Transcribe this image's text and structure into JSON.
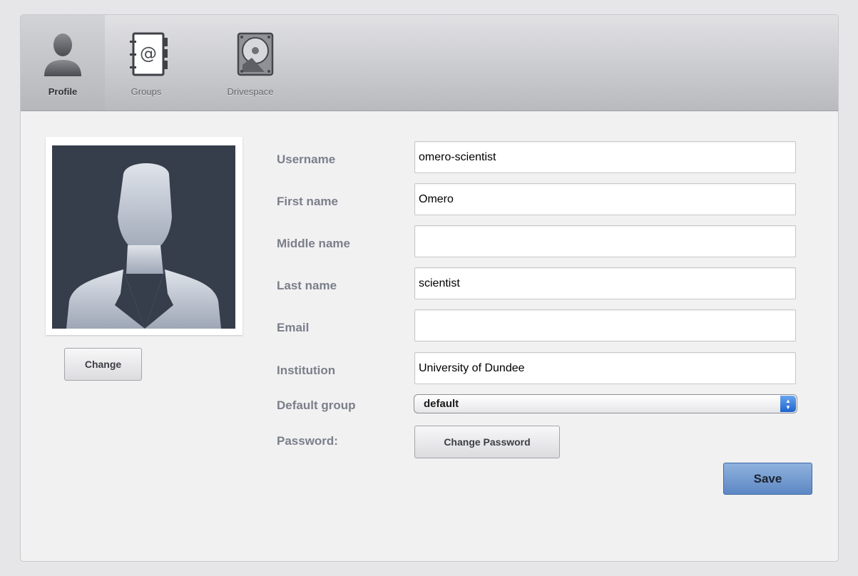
{
  "tabs": [
    {
      "label": "Profile",
      "icon": "person-icon",
      "selected": true
    },
    {
      "label": "Groups",
      "icon": "address-book-icon",
      "selected": false
    },
    {
      "label": "Drivespace",
      "icon": "hard-drive-icon",
      "selected": false
    }
  ],
  "photo": {
    "change_label": "Change"
  },
  "form": {
    "fields": [
      {
        "label": "Username",
        "value": "omero-scientist"
      },
      {
        "label": "First name",
        "value": "Omero"
      },
      {
        "label": "Middle name",
        "value": ""
      },
      {
        "label": "Last name",
        "value": "scientist"
      },
      {
        "label": "Email",
        "value": ""
      },
      {
        "label": "Institution",
        "value": "University of Dundee"
      }
    ],
    "default_group": {
      "label": "Default group",
      "value": "default"
    },
    "password": {
      "label": "Password:",
      "button": "Change Password"
    },
    "save_label": "Save"
  },
  "colors": {
    "accent": "#5d88c4",
    "label": "#7b7f8a",
    "photo_bg": "#363d4b"
  }
}
